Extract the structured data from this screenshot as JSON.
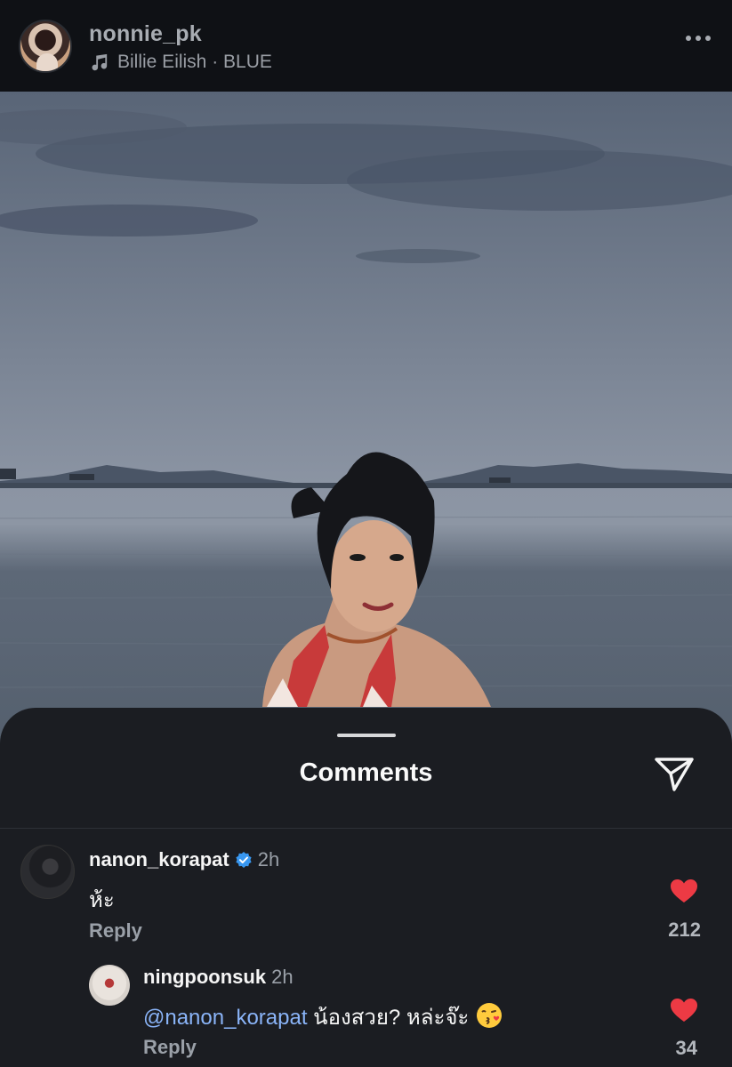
{
  "post": {
    "username": "nonnie_pk",
    "audio": "Billie Eilish · BLUE"
  },
  "comments_sheet": {
    "title": "Comments",
    "comments": [
      {
        "username": "nanon_korapat",
        "verified": true,
        "time": "2h",
        "text": "ห้ะ",
        "reply_label": "Reply",
        "likes": "212",
        "liked": true
      },
      {
        "username": "ningpoonsuk",
        "verified": false,
        "time": "2h",
        "mention": "@nanon_korapat",
        "text": " น้องสวย? หล่ะจ๊ะ",
        "emoji": "kissing-face-emoji",
        "reply_label": "Reply",
        "likes": "34",
        "liked": true
      }
    ]
  },
  "colors": {
    "heart": "#ed3a44",
    "mention": "#8ab4f8",
    "verified": "#3897f0"
  }
}
